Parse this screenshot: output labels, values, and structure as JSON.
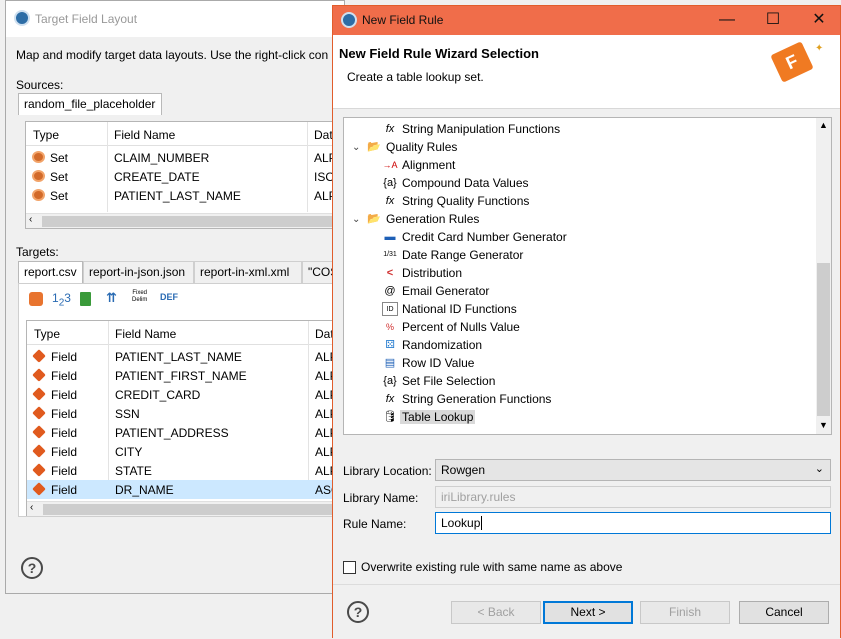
{
  "bg_dialog": {
    "title": "Target Field Layout",
    "description": "Map and modify target data layouts. Use the right-click con",
    "sources_label": "Sources:",
    "source_tab": "random_file_placeholder",
    "columns": [
      "Type",
      "Field Name",
      "Dat"
    ],
    "source_rows": [
      {
        "type": "Set",
        "name": "CLAIM_NUMBER",
        "dt": "ALP"
      },
      {
        "type": "Set",
        "name": "CREATE_DATE",
        "dt": "ISO_"
      },
      {
        "type": "Set",
        "name": "PATIENT_LAST_NAME",
        "dt": "ALP"
      }
    ],
    "targets_label": "Targets:",
    "target_tabs": [
      "report.csv",
      "report-in-json.json",
      "report-in-xml.xml",
      "\"COS"
    ],
    "toolbar": {
      "fixed_label": "Fixed\nDelim",
      "def_label": "DEF"
    },
    "target_rows": [
      {
        "type": "Field",
        "name": "PATIENT_LAST_NAME",
        "dt": "ALP"
      },
      {
        "type": "Field",
        "name": "PATIENT_FIRST_NAME",
        "dt": "ALP"
      },
      {
        "type": "Field",
        "name": "CREDIT_CARD",
        "dt": "ALP"
      },
      {
        "type": "Field",
        "name": "SSN",
        "dt": "ALP"
      },
      {
        "type": "Field",
        "name": "PATIENT_ADDRESS",
        "dt": "ALP"
      },
      {
        "type": "Field",
        "name": "CITY",
        "dt": "ALP"
      },
      {
        "type": "Field",
        "name": "STATE",
        "dt": "ALP"
      },
      {
        "type": "Field",
        "name": "DR_NAME",
        "dt": "ASC"
      }
    ]
  },
  "dialog": {
    "title": "New Field Rule",
    "heading": "New Field Rule Wizard Selection",
    "subheading": "Create a table lookup set.",
    "tree": [
      {
        "label": "String Manipulation Functions",
        "icon": "fx-icon",
        "glyph": "fx"
      },
      {
        "label": "Quality Rules",
        "icon": "folder-icon",
        "glyph": "📂"
      },
      {
        "label": "Alignment",
        "icon": "align-icon",
        "glyph": "→A"
      },
      {
        "label": "Compound Data Values",
        "icon": "compound-icon",
        "glyph": "{a}"
      },
      {
        "label": "String Quality Functions",
        "icon": "fx-icon",
        "glyph": "fx"
      },
      {
        "label": "Generation Rules",
        "icon": "folder-icon",
        "glyph": "📂"
      },
      {
        "label": "Credit Card Number Generator",
        "icon": "credit-card-icon",
        "glyph": "▬"
      },
      {
        "label": "Date Range Generator",
        "icon": "date-icon",
        "glyph": "1/31"
      },
      {
        "label": "Distribution",
        "icon": "distribution-icon",
        "glyph": "<"
      },
      {
        "label": "Email Generator",
        "icon": "email-icon",
        "glyph": "@"
      },
      {
        "label": "National ID Functions",
        "icon": "id-card-icon",
        "glyph": "ID"
      },
      {
        "label": "Percent of Nulls Value",
        "icon": "nulls-icon",
        "glyph": "%"
      },
      {
        "label": "Randomization",
        "icon": "dice-icon",
        "glyph": "⚄"
      },
      {
        "label": "Row ID Value",
        "icon": "row-id-icon",
        "glyph": "▤"
      },
      {
        "label": "Set File Selection",
        "icon": "set-file-icon",
        "glyph": "{a}"
      },
      {
        "label": "String Generation Functions",
        "icon": "fx-icon",
        "glyph": "fx"
      },
      {
        "label": "Table Lookup",
        "icon": "database-icon",
        "glyph": "🛢"
      }
    ],
    "library_location_label": "Library Location:",
    "library_location_value": "Rowgen",
    "library_name_label": "Library Name:",
    "library_name_value": "iriLibrary.rules",
    "rule_name_label": "Rule Name:",
    "rule_name_value": "Lookup",
    "overwrite_label": "Overwrite existing rule with same name as above",
    "buttons": {
      "back": "< Back",
      "next": "Next >",
      "finish": "Finish",
      "cancel": "Cancel"
    }
  },
  "colors": {
    "title_bar": "#f06d4a",
    "selection": "#cce8ff",
    "accent": "#0078d7"
  }
}
